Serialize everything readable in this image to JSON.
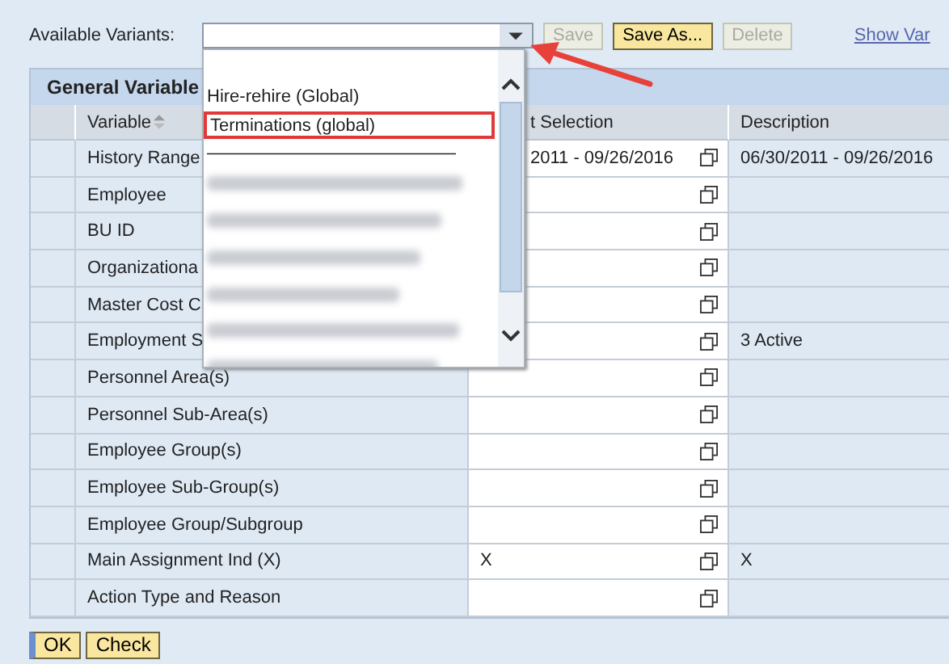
{
  "variants": {
    "label": "Available Variants:",
    "buttons": [
      {
        "label": "Save",
        "disabled": true,
        "kind": "plain"
      },
      {
        "label": "Save As...",
        "disabled": false,
        "kind": "plain"
      },
      {
        "label": "Delete",
        "disabled": true,
        "kind": "plain"
      }
    ],
    "link": "Show Var"
  },
  "dropdown": {
    "items": [
      {
        "kind": "blank"
      },
      {
        "kind": "text",
        "label": "Hire-rehire (Global)",
        "highlighted": false
      },
      {
        "kind": "text",
        "label": "Terminations (global)",
        "highlighted": true
      },
      {
        "kind": "text",
        "label": "——————————————",
        "highlighted": false
      },
      {
        "kind": "blurred"
      },
      {
        "kind": "blurred"
      },
      {
        "kind": "blurred"
      },
      {
        "kind": "blurred"
      },
      {
        "kind": "blurred"
      },
      {
        "kind": "blurred"
      }
    ]
  },
  "panel": {
    "title": "General Variable"
  },
  "table": {
    "columns": [
      "Variable",
      "t Selection",
      "Description"
    ],
    "rows": [
      {
        "variable": "History Range",
        "current": "2011 - 09/26/2016",
        "description": "06/30/2011 - 09/26/2016"
      },
      {
        "variable": "Employee",
        "current": "",
        "description": ""
      },
      {
        "variable": "BU ID",
        "current": "",
        "description": ""
      },
      {
        "variable": "Organizationa",
        "current": "",
        "description": ""
      },
      {
        "variable": "Master Cost C",
        "current": "",
        "description": ""
      },
      {
        "variable": "Employment S",
        "current": "",
        "description": "3 Active"
      },
      {
        "variable": "Personnel Area(s)",
        "current": "",
        "description": ""
      },
      {
        "variable": "Personnel Sub-Area(s)",
        "current": "",
        "description": ""
      },
      {
        "variable": "Employee Group(s)",
        "current": "",
        "description": ""
      },
      {
        "variable": "Employee Sub-Group(s)",
        "current": "",
        "description": ""
      },
      {
        "variable": "Employee Group/Subgroup",
        "current": "",
        "description": ""
      },
      {
        "variable": "Main Assignment Ind (X)",
        "current": "X",
        "description": "X"
      },
      {
        "variable": "Action Type and Reason",
        "current": "",
        "description": ""
      }
    ]
  },
  "footer_buttons": [
    {
      "label": "OK",
      "focused": true
    },
    {
      "label": "Check",
      "focused": false
    }
  ]
}
